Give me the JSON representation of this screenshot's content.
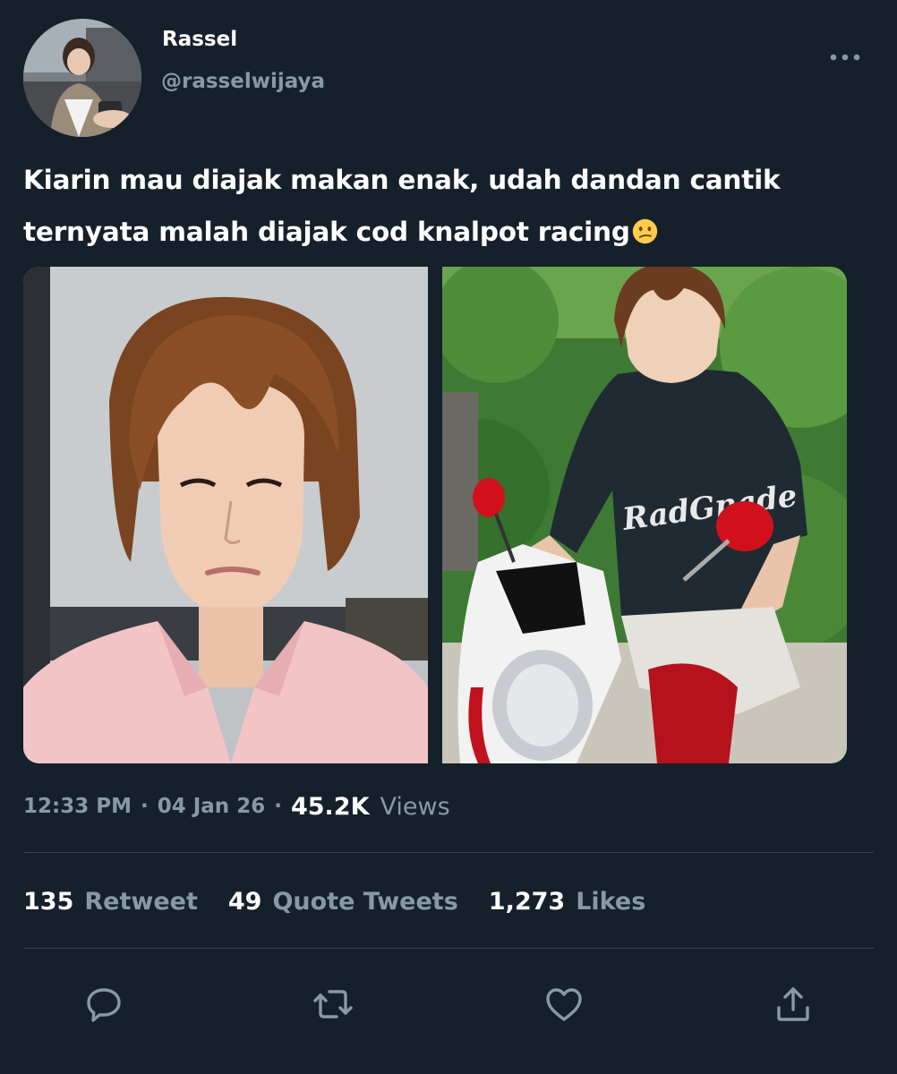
{
  "author": {
    "display_name": "Rassel",
    "handle": "@rasselwijaya"
  },
  "tweet": {
    "text_line1": "Kiarin mau diajak makan enak, udah dandan cantik",
    "text_line2": "ternyata malah diajak cod knalpot racing",
    "emoji": "confused-face-emoji"
  },
  "media": {
    "photos": [
      {
        "name": "photo-portrait-pink-shirt"
      },
      {
        "name": "photo-scooter-rider"
      }
    ],
    "print_on_shirt": "RadGnade"
  },
  "meta": {
    "time": "12:33 PM",
    "date": "04 Jan 26",
    "separator": "·",
    "views_count": "45.2K",
    "views_label": "Views"
  },
  "stats": {
    "retweets_count": "135",
    "retweets_label": "Retweet",
    "quotes_count": "49",
    "quotes_label": "Quote Tweets",
    "likes_count": "1,273",
    "likes_label": "Likes"
  },
  "actions": {
    "icons": [
      "reply-icon",
      "retweet-icon",
      "like-icon",
      "share-icon"
    ]
  },
  "colors": {
    "background": "#15202b",
    "primary_text": "#ffffff",
    "secondary_text": "#8899a6",
    "divider": "#38444d"
  }
}
